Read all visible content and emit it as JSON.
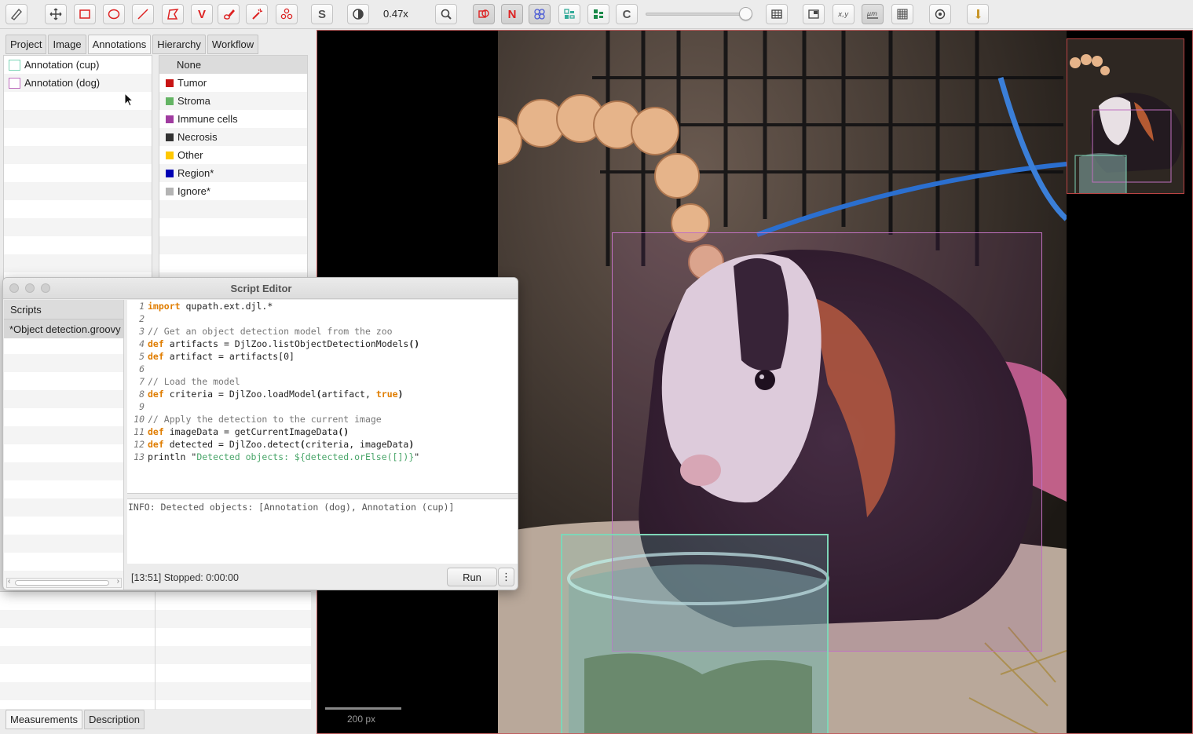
{
  "toolbar": {
    "zoom_level": "0.47x",
    "tools": [
      {
        "name": "brush-tool",
        "label": ""
      },
      {
        "name": "move-tool",
        "label": ""
      },
      {
        "name": "rectangle-tool",
        "label": ""
      },
      {
        "name": "ellipse-tool",
        "label": ""
      },
      {
        "name": "line-tool",
        "label": ""
      },
      {
        "name": "polygon-tool",
        "label": ""
      },
      {
        "name": "polyline-tool",
        "label": "V"
      },
      {
        "name": "brush-annot-tool",
        "label": ""
      },
      {
        "name": "wand-tool",
        "label": ""
      },
      {
        "name": "points-tool",
        "label": ""
      }
    ],
    "s_label": "S",
    "n_label": "N",
    "c_label": "C"
  },
  "left": {
    "tabs": [
      "Project",
      "Image",
      "Annotations",
      "Hierarchy",
      "Workflow"
    ],
    "annotations": [
      {
        "label": "Annotation (cup)",
        "color": "#7ed6b8"
      },
      {
        "label": "Annotation (dog)",
        "color": "#c070c0"
      }
    ],
    "classes_header": "None",
    "classes": [
      {
        "label": "Tumor",
        "color": "#c81414"
      },
      {
        "label": "Stroma",
        "color": "#64b464"
      },
      {
        "label": "Immune cells",
        "color": "#a03ca0"
      },
      {
        "label": "Necrosis",
        "color": "#323232"
      },
      {
        "label": "Other",
        "color": "#ffc800"
      },
      {
        "label": "Region*",
        "color": "#0000b4"
      },
      {
        "label": "Ignore*",
        "color": "#b4b4b4"
      }
    ],
    "bottom_tabs": [
      "Measurements",
      "Description"
    ]
  },
  "viewer": {
    "scale_label": "200 px"
  },
  "script_editor": {
    "title": "Script Editor",
    "scripts_header": "Scripts",
    "script_item": "*Object detection.groovy",
    "code_lines": [
      "1",
      "2",
      "3",
      "4",
      "5",
      "6",
      "7",
      "8",
      "9",
      "10",
      "11",
      "12",
      "13"
    ],
    "code": {
      "l1_kw": "import",
      "l1_rest": " qupath.ext.djl.*",
      "l3": "// Get an object detection model from the zoo",
      "l4_kw": "def",
      "l4_rest": " artifacts = DjlZoo.listObjectDetectionModels",
      "l5_kw": "def",
      "l5_rest": " artifact = artifacts[0]",
      "l7": "// Load the model",
      "l8_kw": "def",
      "l8_rest": " criteria = DjlZoo.loadModel",
      "l8_arg": "artifact, ",
      "l8_true": "true",
      "l10": "// Apply the detection to the current image",
      "l11_kw": "def",
      "l11_rest": " imageData = getCurrentImageData",
      "l12_kw": "def",
      "l12_rest": " detected = DjlZoo.detect",
      "l12_arg": "criteria, imageData",
      "l13_pre": "println \"",
      "l13_str": "Detected objects: ${detected.orElse([])}",
      "l13_post": "\""
    },
    "console_text": "INFO: Detected objects: [Annotation (dog), Annotation (cup)]",
    "status": "[13:51]   Stopped: 0:00:00",
    "run_label": "Run",
    "more_label": "⋮"
  }
}
